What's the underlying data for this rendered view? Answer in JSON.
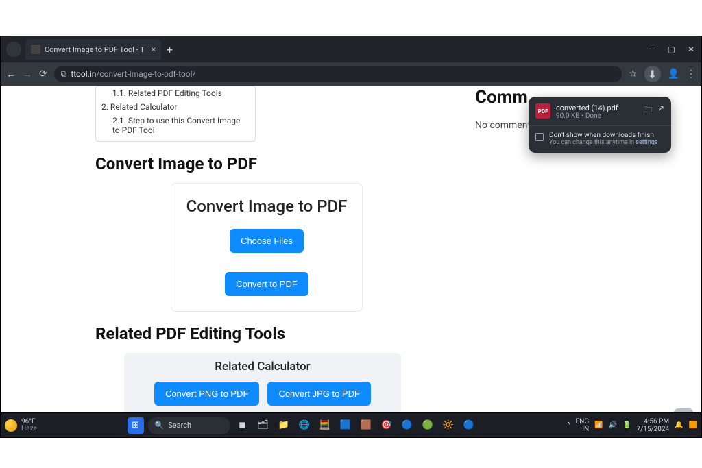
{
  "browser": {
    "tab_title": "Convert Image to PDF Tool - T",
    "url_host": "ttool.in",
    "url_path": "/convert-image-to-pdf-tool/"
  },
  "toc": {
    "items": [
      {
        "num": "1.1.",
        "label": "Related PDF Editing Tools",
        "sub": true
      },
      {
        "num": "2.",
        "label": "Related Calculator",
        "sub": false
      },
      {
        "num": "2.1.",
        "label": "Step to use this Convert Image to PDF Tool",
        "sub": true
      }
    ]
  },
  "headings": {
    "h_convert": "Convert Image to PDF",
    "h_related_tools": "Related PDF Editing Tools",
    "h_step": "Step to use this Convert Image to PDF Tool"
  },
  "card": {
    "title": "Convert Image to PDF",
    "choose": "Choose Files",
    "convert": "Convert to PDF"
  },
  "related_calc": {
    "title": "Related Calculator",
    "png": "Convert PNG to PDF",
    "jpg": "Convert JPG to PDF"
  },
  "sidebar": {
    "heading": "Comm",
    "no_comments": "No comment"
  },
  "download": {
    "filename": "converted (14).pdf",
    "meta": "90.0 KB • Done",
    "opt_line1": "Don't show when downloads finish",
    "opt_line2_pre": "You can change this anytime in ",
    "opt_link": "settings"
  },
  "taskbar": {
    "weather_temp": "96°F",
    "weather_desc": "Haze",
    "search_placeholder": "Search",
    "lang_top": "ENG",
    "lang_bottom": "IN",
    "time": "4:56 PM",
    "date": "7/15/2024"
  }
}
